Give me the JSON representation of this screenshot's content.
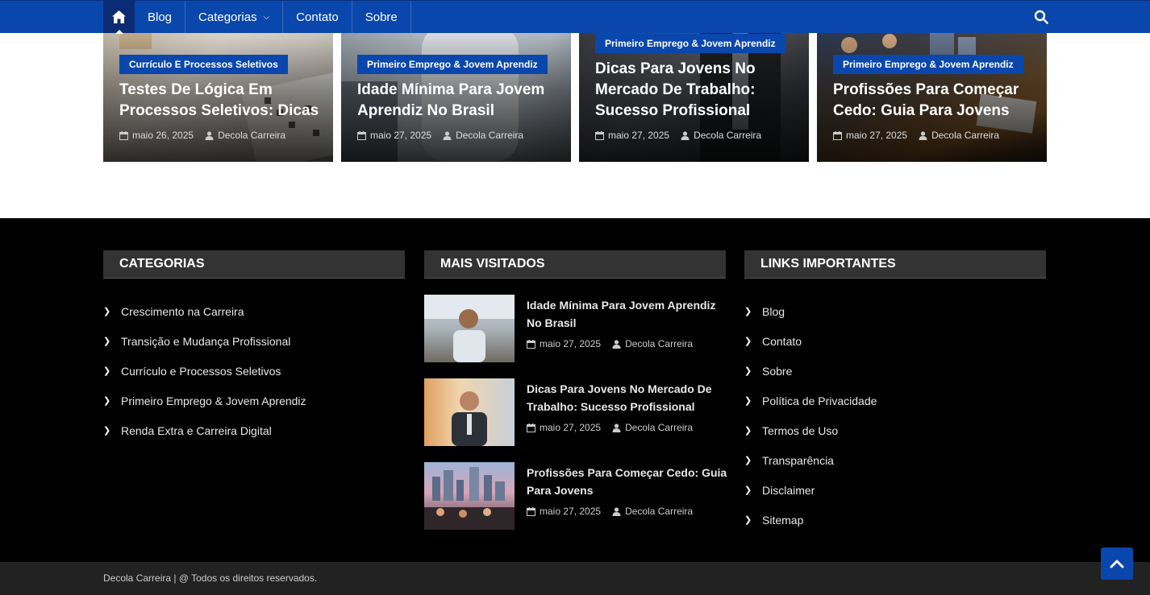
{
  "nav": {
    "home_icon": "home-icon",
    "items": [
      {
        "label": "Blog"
      },
      {
        "label": "Categorias"
      },
      {
        "label": "Contato"
      },
      {
        "label": "Sobre"
      }
    ],
    "search_icon": "search-icon",
    "colors": {
      "bar": "#0a47ad",
      "home": "#0b2c74"
    }
  },
  "cards": [
    {
      "category": "Currículo E Processos Seletivos",
      "title": "Testes De Lógica Em Processos Seletivos: Dicas",
      "date": "maio 26, 2025",
      "author": "Decola Carreira"
    },
    {
      "category": "Primeiro Emprego & Jovem Aprendiz",
      "title": "Idade Mínima Para Jovem Aprendiz No Brasil",
      "date": "maio 27, 2025",
      "author": "Decola Carreira"
    },
    {
      "category": "Primeiro Emprego & Jovem Aprendiz",
      "title": "Dicas Para Jovens No Mercado De Trabalho: Sucesso Profissional",
      "date": "maio 27, 2025",
      "author": "Decola Carreira"
    },
    {
      "category": "Primeiro Emprego & Jovem Aprendiz",
      "title": "Profissões Para Começar Cedo: Guia Para Jovens",
      "date": "maio 27, 2025",
      "author": "Decola Carreira"
    }
  ],
  "footer": {
    "categories": {
      "heading": "CATEGORIAS",
      "items": [
        "Crescimento na Carreira",
        "Transição e Mudança Profissional",
        "Currículo e Processos Seletivos",
        "Primeiro Emprego & Jovem Aprendiz",
        "Renda Extra e Carreira Digital"
      ]
    },
    "most_visited": {
      "heading": "MAIS VISITADOS",
      "posts": [
        {
          "title": "Idade Mínima Para Jovem Aprendiz No Brasil",
          "date": "maio 27, 2025",
          "author": "Decola Carreira"
        },
        {
          "title": "Dicas Para Jovens No Mercado De Trabalho: Sucesso Profissional",
          "date": "maio 27, 2025",
          "author": "Decola Carreira"
        },
        {
          "title": "Profissões Para Começar Cedo: Guia Para Jovens",
          "date": "maio 27, 2025",
          "author": "Decola Carreira"
        }
      ]
    },
    "links": {
      "heading": "LINKS IMPORTANTES",
      "items": [
        "Blog",
        "Contato",
        "Sobre",
        "Política de Privacidade",
        "Termos de Uso",
        "Transparência",
        "Disclaimer",
        "Sitemap"
      ]
    },
    "copyright": "Decola Carreira | @ Todos os direitos reservados.",
    "back_to_top_icon": "chevron-up-icon"
  }
}
